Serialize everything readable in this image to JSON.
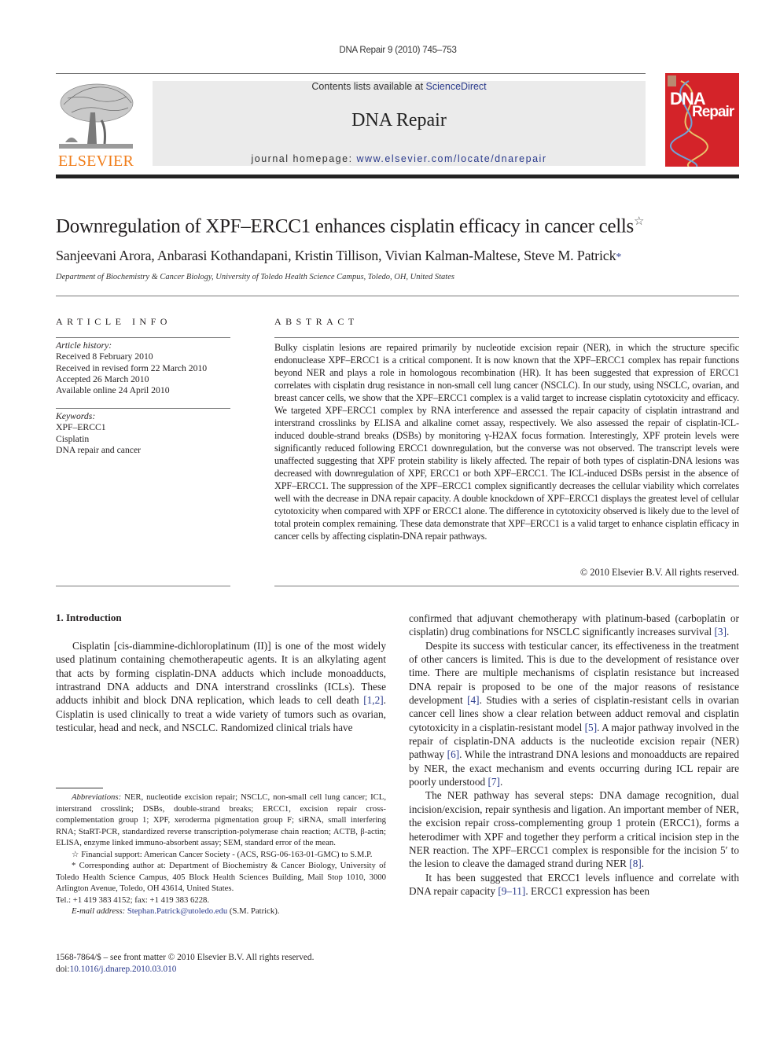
{
  "header": {
    "citation": "DNA Repair 9 (2010) 745–753",
    "contents_prefix": "Contents lists available at ",
    "contents_link": "ScienceDirect",
    "journal_name": "DNA Repair",
    "homepage_prefix": "journal homepage: ",
    "homepage_link": "www.elsevier.com/locate/dnarepair",
    "publisher_logo_text": "ELSEVIER",
    "cover_title_line1": "DNA",
    "cover_title_line2": "Repair",
    "colors": {
      "publisher_orange": "#f07d1a",
      "cover_red": "#d42329",
      "link_blue": "#2a3a8c",
      "masthead_gray": "#ebebeb"
    }
  },
  "article": {
    "title": "Downregulation of XPF–ERCC1 enhances cisplatin efficacy in cancer cells",
    "title_mark": "☆",
    "authors": "Sanjeevani Arora, Anbarasi Kothandapani, Kristin Tillison, Vivian Kalman-Maltese, Steve M. Patrick",
    "corresponding_mark": "*",
    "affiliation": "Department of Biochemistry & Cancer Biology, University of Toledo Health Science Campus, Toledo, OH, United States"
  },
  "article_info": {
    "heading": "ARTICLE INFO",
    "history_label": "Article history:",
    "history": [
      "Received 8 February 2010",
      "Received in revised form 22 March 2010",
      "Accepted 26 March 2010",
      "Available online 24 April 2010"
    ],
    "keywords_label": "Keywords:",
    "keywords": [
      "XPF–ERCC1",
      "Cisplatin",
      "DNA repair and cancer"
    ]
  },
  "abstract": {
    "heading": "ABSTRACT",
    "text": "Bulky cisplatin lesions are repaired primarily by nucleotide excision repair (NER), in which the structure specific endonuclease XPF–ERCC1 is a critical component. It is now known that the XPF–ERCC1 complex has repair functions beyond NER and plays a role in homologous recombination (HR). It has been suggested that expression of ERCC1 correlates with cisplatin drug resistance in non-small cell lung cancer (NSCLC). In our study, using NSCLC, ovarian, and breast cancer cells, we show that the XPF–ERCC1 complex is a valid target to increase cisplatin cytotoxicity and efficacy. We targeted XPF–ERCC1 complex by RNA interference and assessed the repair capacity of cisplatin intrastrand and interstrand crosslinks by ELISA and alkaline comet assay, respectively. We also assessed the repair of cisplatin-ICL-induced double-strand breaks (DSBs) by monitoring γ-H2AX focus formation. Interestingly, XPF protein levels were significantly reduced following ERCC1 downregulation, but the converse was not observed. The transcript levels were unaffected suggesting that XPF protein stability is likely affected. The repair of both types of cisplatin-DNA lesions was decreased with downregulation of XPF, ERCC1 or both XPF–ERCC1. The ICL-induced DSBs persist in the absence of XPF–ERCC1. The suppression of the XPF–ERCC1 complex significantly decreases the cellular viability which correlates well with the decrease in DNA repair capacity. A double knockdown of XPF–ERCC1 displays the greatest level of cellular cytotoxicity when compared with XPF or ERCC1 alone. The difference in cytotoxicity observed is likely due to the level of total protein complex remaining. These data demonstrate that XPF–ERCC1 is a valid target to enhance cisplatin efficacy in cancer cells by affecting cisplatin-DNA repair pathways.",
    "copyright": "© 2010 Elsevier B.V. All rights reserved."
  },
  "introduction": {
    "heading": "1.  Introduction",
    "left_p1_a": "Cisplatin [cis-diammine-dichloroplatinum (II)] is one of the most widely used platinum containing chemotherapeutic agents. It is an alkylating agent that acts by forming cisplatin-DNA adducts which include monoadducts, intrastrand DNA adducts and DNA interstrand crosslinks (ICLs). These adducts inhibit and block DNA replication, which leads to cell death ",
    "left_p1_ref1": "[1,2]",
    "left_p1_b": ". Cisplatin is used clinically to treat a wide variety of tumors such as ovarian, testicular, head and neck, and NSCLC. Randomized clinical trials have",
    "right_p1_a": "confirmed that adjuvant chemotherapy with platinum-based (carboplatin or cisplatin) drug combinations for NSCLC significantly increases survival ",
    "right_p1_ref": "[3]",
    "right_p1_b": ".",
    "right_p2_a": "Despite its success with testicular cancer, its effectiveness in the treatment of other cancers is limited. This is due to the development of resistance over time. There are multiple mechanisms of cisplatin resistance but increased DNA repair is proposed to be one of the major reasons of resistance development ",
    "right_p2_ref1": "[4]",
    "right_p2_b": ". Studies with a series of cisplatin-resistant cells in ovarian cancer cell lines show a clear relation between adduct removal and cisplatin cytotoxicity in a cisplatin-resistant model ",
    "right_p2_ref2": "[5]",
    "right_p2_c": ". A major pathway involved in the repair of cisplatin-DNA adducts is the nucleotide excision repair (NER) pathway ",
    "right_p2_ref3": "[6]",
    "right_p2_d": ". While the intrastrand DNA lesions and monoadducts are repaired by NER, the exact mechanism and events occurring during ICL repair are poorly understood ",
    "right_p2_ref4": "[7]",
    "right_p2_e": ".",
    "right_p3_a": "The NER pathway has several steps: DNA damage recognition, dual incision/excision, repair synthesis and ligation. An important member of NER, the excision repair cross-complementing group 1 protein (ERCC1), forms a heterodimer with XPF and together they perform a critical incision step in the NER reaction. The XPF–ERCC1 complex is responsible for the incision 5′ to the lesion to cleave the damaged strand during NER ",
    "right_p3_ref": "[8]",
    "right_p3_b": ".",
    "right_p4_a": "It has been suggested that ERCC1 levels influence and correlate with DNA repair capacity ",
    "right_p4_ref": "[9–11]",
    "right_p4_b": ". ERCC1 expression has been"
  },
  "footnotes": {
    "abbrev_label": "Abbreviations:",
    "abbrev_text": " NER, nucleotide excision repair; NSCLC, non-small cell lung cancer; ICL, interstrand crosslink; DSBs, double-strand breaks; ERCC1, excision repair cross-complementation group 1; XPF, xeroderma pigmentation group F; siRNA, small interfering RNA; StaRT-PCR, standardized reverse transcription-polymerase chain reaction; ACTB, β-actin; ELISA, enzyme linked immuno-absorbent assay; SEM, standard error of the mean.",
    "funding_mark": "☆",
    "funding": " Financial support: American Cancer Society - (ACS, RSG-06-163-01-GMC) to S.M.P.",
    "corr_mark": "*",
    "corresponding": " Corresponding author at: Department of Biochemistry & Cancer Biology, University of Toledo Health Science Campus, 405 Block Health Sciences Building, Mail Stop 1010, 3000 Arlington Avenue, Toledo, OH 43614, United States.",
    "phone": "Tel.: +1 419 383 4152; fax: +1 419 383 6228.",
    "email_label": "E-mail address:",
    "email": "Stephan.Patrick@utoledo.edu",
    "email_suffix": " (S.M. Patrick)."
  },
  "front_matter": {
    "issn_line": "1568-7864/$ – see front matter © 2010 Elsevier B.V. All rights reserved.",
    "doi_prefix": "doi:",
    "doi": "10.1016/j.dnarep.2010.03.010"
  }
}
